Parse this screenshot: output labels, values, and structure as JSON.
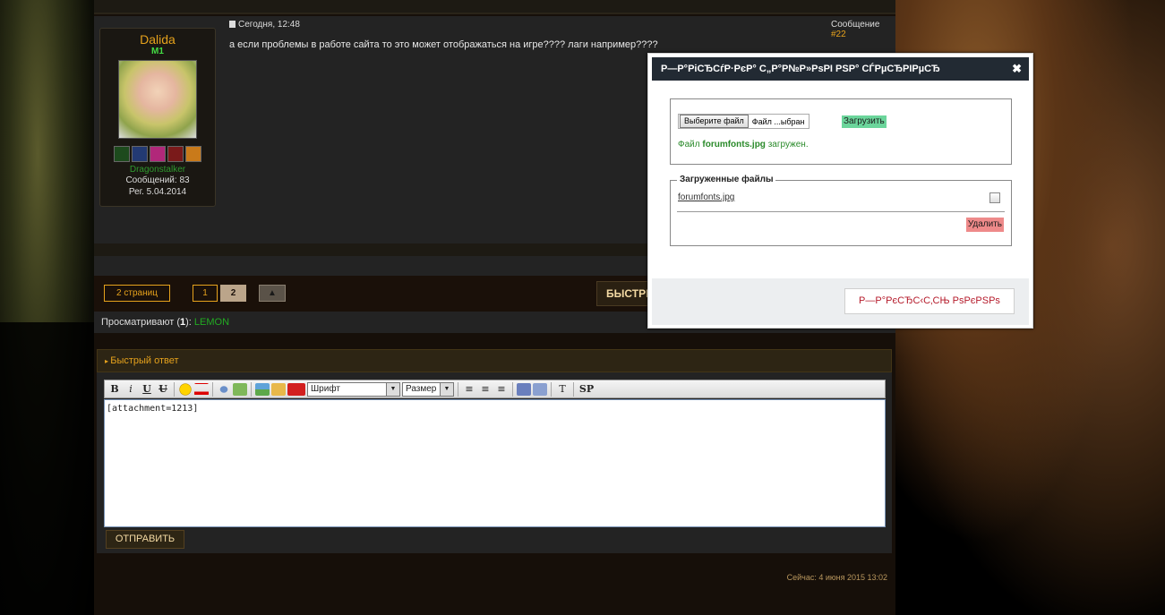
{
  "post": {
    "date": "Сегодня, 12:48",
    "number_prefix": "Сообщение ",
    "number": "#22",
    "text": "а если проблемы в работе сайта то это может отображаться на игре???? лаги например????"
  },
  "author": {
    "name": "Dalida",
    "rank": "M1",
    "guild": "Dragonstalker",
    "messages": "Сообщений: 83",
    "registered": "Рег. 5.04.2014",
    "badges": [
      "green-badge",
      "blue-badge",
      "pink-badge",
      "red-badge",
      "orange-badge"
    ]
  },
  "pager": {
    "label": "2 страниц",
    "pages": [
      "1",
      "2"
    ],
    "current": "2",
    "arrow": "▲",
    "quick_button": "БЫСТРЫ"
  },
  "viewers": {
    "prefix": "Просматривают (",
    "count": "1",
    "suffix": "):",
    "user": "LEMON"
  },
  "quick_reply": {
    "title": "Быстрый ответ",
    "font_select": "Шрифт",
    "size_select": "Размер",
    "editor_text": "[attachment=1213]",
    "send_label": "ОТПРАВИТЬ",
    "toolbar": {
      "bold": "B",
      "italic": "i",
      "underline": "U",
      "strike": "U",
      "text_tool": "T",
      "sp": "SP"
    }
  },
  "footer": {
    "time": "Сейчас: 4 июня 2015 13:02"
  },
  "modal": {
    "title": "Р—Р°РіСЂСѓР·РєР° С„Р°Р№Р»РѕРІ РЅР° СЃРµСЂРІРµСЂ",
    "close": "✖",
    "choose_file": "Выберите файл",
    "file_chosen": "Файл ...ыбран",
    "upload_label": "Загрузить",
    "upload_msg_prefix": "Файл ",
    "upload_msg_file": "forumfonts.jpg",
    "upload_msg_suffix": " загружен.",
    "uploaded_legend": "Загруженные файлы",
    "uploaded_file": "forumfonts.jpg",
    "delete_label": "Удалить",
    "footer_button": "Р—Р°РєСЂС‹С‚СЊ РѕРєРЅРѕ"
  },
  "colors": {
    "accent": "#e6a21c",
    "link_green": "#22aa22",
    "upload_green": "#6bd59b",
    "delete_red": "#ee8a8a"
  }
}
